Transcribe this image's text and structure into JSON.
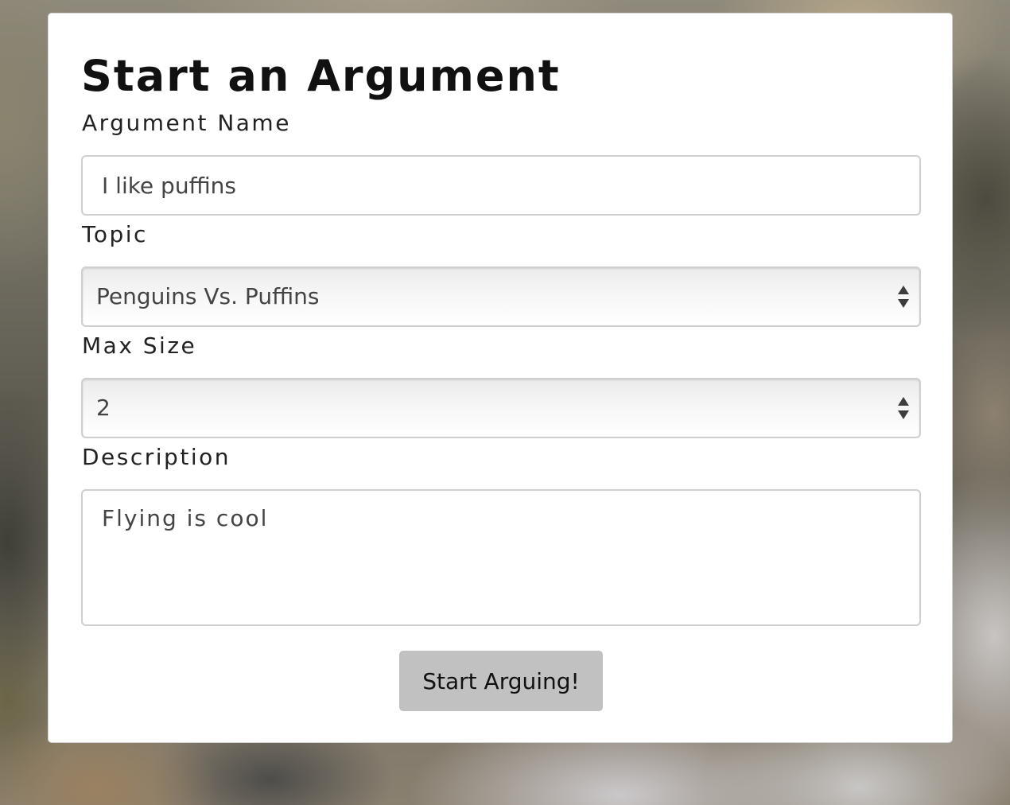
{
  "form": {
    "title": "Start an Argument",
    "argument_name": {
      "label": "Argument Name",
      "value": "I like puffins"
    },
    "topic": {
      "label": "Topic",
      "selected": "Penguins Vs. Puffins"
    },
    "max_size": {
      "label": "Max Size",
      "selected": "2"
    },
    "description": {
      "label": "Description",
      "value": "Flying is cool"
    },
    "submit_label": "Start Arguing!"
  },
  "icons": {
    "select_arrows": "up-down-arrows-icon"
  },
  "colors": {
    "card_background": "#ffffff",
    "button_background": "#c1c1c1",
    "input_border": "#cfcfcf",
    "text": "#111111"
  }
}
